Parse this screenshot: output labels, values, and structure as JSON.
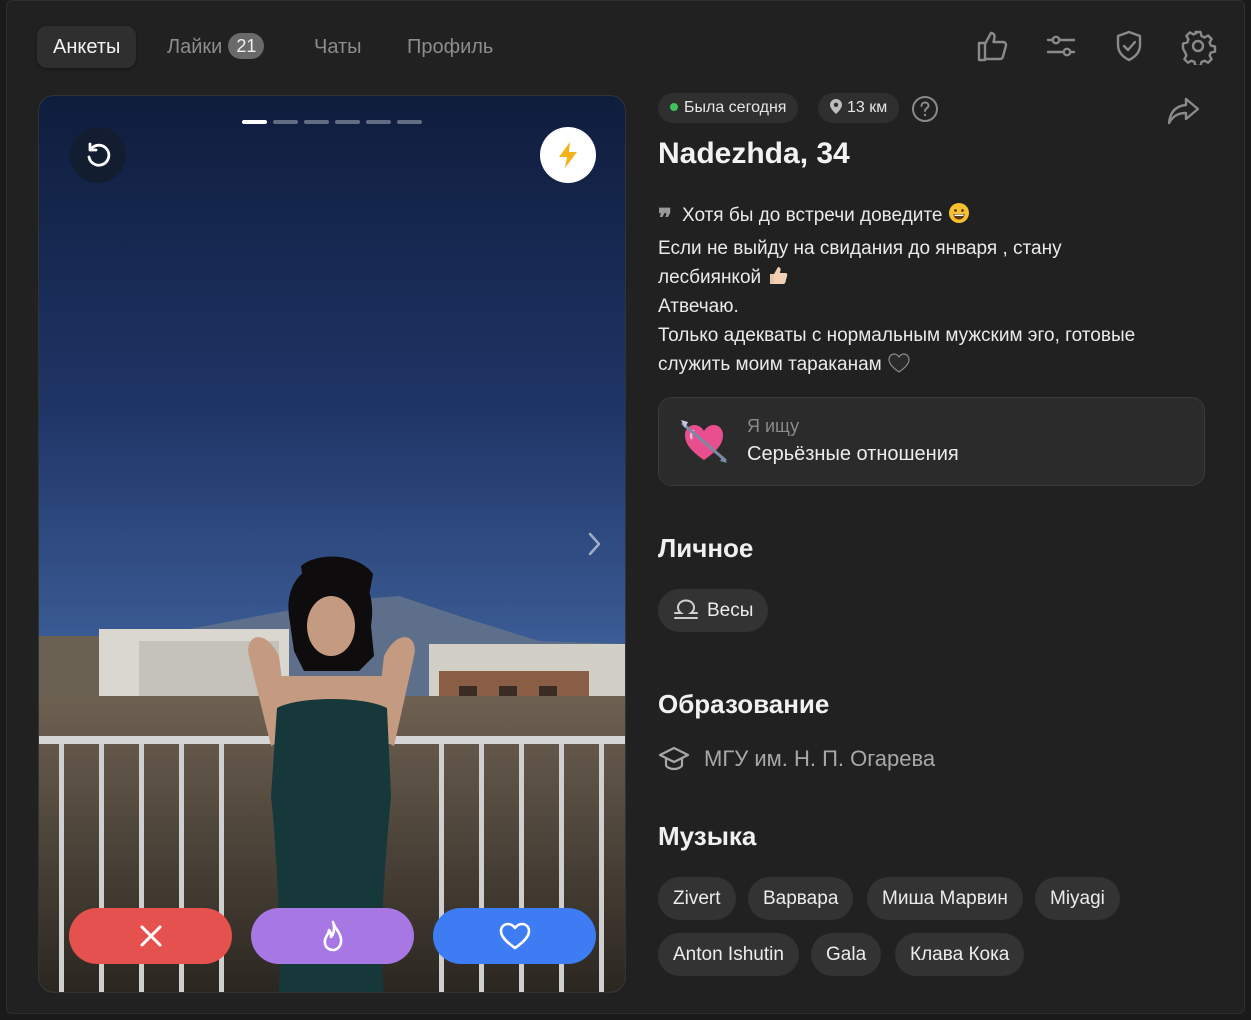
{
  "nav": {
    "tabs": [
      {
        "label": "Анкеты",
        "active": true
      },
      {
        "label": "Лайки",
        "badge": "21"
      },
      {
        "label": "Чаты"
      },
      {
        "label": "Профиль"
      }
    ],
    "icons": [
      "thumbs-up-icon",
      "filter-sliders-icon",
      "shield-check-icon",
      "gear-icon"
    ]
  },
  "photo": {
    "count": 6,
    "current": 1,
    "undo_icon": "undo-icon",
    "boost_icon": "lightning-icon",
    "actions": [
      {
        "name": "dislike-button",
        "icon": "close-icon",
        "color": "#e5514f"
      },
      {
        "name": "superlike-button",
        "icon": "flame-icon",
        "color": "#a777e3"
      },
      {
        "name": "like-button",
        "icon": "heart-icon",
        "color": "#3d7cf3"
      }
    ]
  },
  "profile": {
    "status": "Была сегодня",
    "status_color": "#3fc25a",
    "distance": "13 км",
    "name": "Nadezhda, 34",
    "bio_lines": [
      "Хотя бы до встречи доведите",
      "Если не выйду на свидания до января , стану",
      "лесбиянкой",
      "Атвечаю.",
      "Только адекваты с нормальным мужским эго, готовые",
      "служить моим тараканам"
    ],
    "seeking_label": "Я ищу",
    "seeking_value": "Серьёзные отношения"
  },
  "sections": {
    "personal_title": "Личное",
    "zodiac": "Весы",
    "education_title": "Образование",
    "education": "МГУ им. Н. П. Огарева",
    "music_title": "Музыка",
    "music": [
      "Zivert",
      "Варвара",
      "Миша Марвин",
      "Miyagi",
      "Anton Ishutin",
      "Gala",
      "Клава Кока"
    ]
  }
}
